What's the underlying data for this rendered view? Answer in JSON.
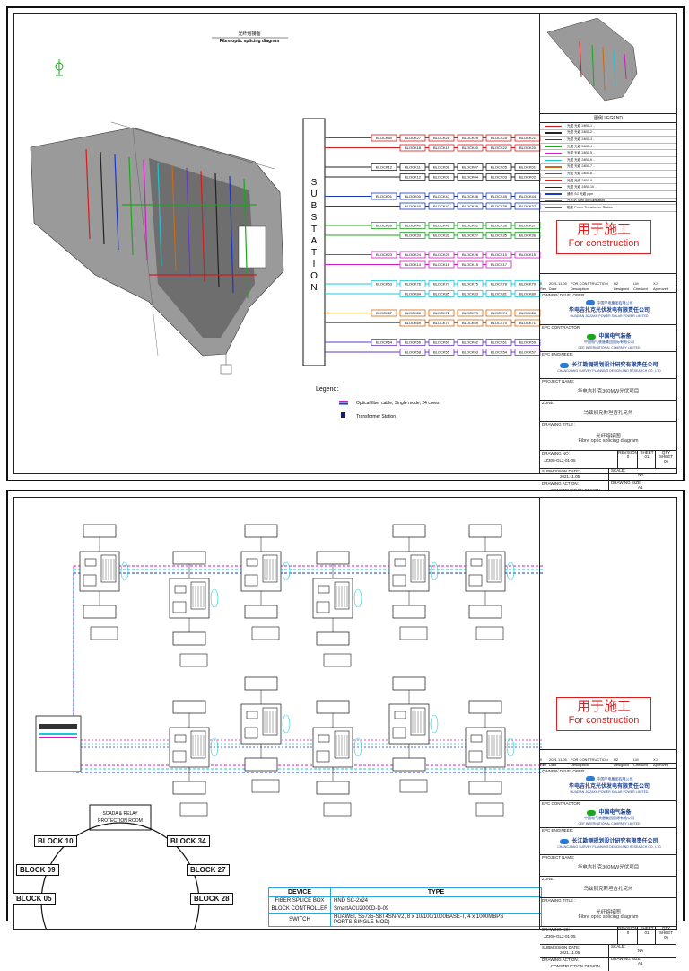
{
  "sheet1": {
    "title_cn": "光纤熔接图",
    "title_en": "Fibre optic splicing diagram",
    "substation_letters": [
      "S",
      "U",
      "B",
      "S",
      "T",
      "A",
      "T",
      "I",
      "O",
      "N"
    ],
    "block_rows": [
      {
        "color": "#d81b1b",
        "cells": [
          [
            "BLOCK50",
            "BLOCK27",
            "BLOCK28",
            "BLOCK29",
            "BLOCK25",
            "BLOCK21"
          ],
          [
            "BLOCK18",
            "BLOCK19",
            "BLOCK20",
            "BLOCK22",
            "BLOCK20"
          ]
        ]
      },
      {
        "color": "#222222",
        "cells": [
          [
            "BLOCK12",
            "BLOCK11",
            "BLOCK08",
            "BLOCK07",
            "BLOCK05",
            "BLOCK01"
          ],
          [
            "BLOCK12",
            "BLOCK09",
            "BLOCK04",
            "BLOCK03",
            "BLOCK02"
          ]
        ]
      },
      {
        "color": "#1a36c8",
        "cells": [
          [
            "BLOCK01",
            "BLOCK00",
            "BLOCK47",
            "BLOCK46",
            "BLOCK45",
            "BLOCK44"
          ],
          [
            "BLOCK40",
            "BLOCK43",
            "BLOCK39",
            "BLOCK38",
            "BLOCK37"
          ]
        ]
      },
      {
        "color": "#1aa81a",
        "cells": [
          [
            "BLOCK39",
            "BLOCK40",
            "BLOCK41",
            "BLOCK42",
            "BLOCK36",
            "BLOCK37"
          ],
          [
            "BLOCK33",
            "BLOCK32",
            "BLOCK27",
            "BLOCK35",
            "BLOCK36"
          ]
        ]
      },
      {
        "color": "#d318c8",
        "cells": [
          [
            "BLOCK23",
            "BLOCK24",
            "BLOCK25",
            "BLOCK26",
            "BLOCK10",
            "BLOCK15"
          ],
          [
            "BLOCK14",
            "BLOCK16",
            "BLOCK15",
            "BLOCK17"
          ]
        ]
      },
      {
        "color": "#18c8d8",
        "cells": [
          [
            "BLOCK63",
            "BLOCK76",
            "BLOCK77",
            "BLOCK75",
            "BLOCK78",
            "BLOCK79"
          ],
          [
            "BLOCK84",
            "BLOCK85",
            "BLOCK83",
            "BLOCK81",
            "BLOCK80"
          ]
        ]
      },
      {
        "color": "#c86a18",
        "cells": [
          [
            "BLOCK67",
            "BLOCK68",
            "BLOCK72",
            "BLOCK73",
            "BLOCK74",
            "BLOCK66"
          ],
          [
            "BLOCK69",
            "BLOCK70",
            "BLOCK69",
            "BLOCK70",
            "BLOCK71"
          ]
        ]
      },
      {
        "color": "#6a3ac8",
        "cells": [
          [
            "BLOCK64",
            "BLOCK56",
            "BLOCK60",
            "BLOCK62",
            "BLOCK61",
            "BLOCK59"
          ],
          [
            "BLOCK58",
            "BLOCK55",
            "BLOCK53",
            "BLOCK54",
            "BLOCK57"
          ]
        ]
      }
    ],
    "legend_title": "Legend:",
    "legend_items": [
      {
        "color": "#d318c8",
        "label": "Optical fiber cable, Single mode, 24 cores"
      },
      {
        "color": "#1a1a6a",
        "label": "Transformer Station"
      }
    ],
    "map_legend_title": "图例    LEGEND",
    "map_legend_rows": [
      "光缆 光缆 24B0-1 ..",
      "光缆 光缆 24B0-2 ..",
      "光缆 光缆 24B0-3 ..",
      "光缆 光缆 24B0-4 ..",
      "光缆 光缆 24B0-5 ..",
      "光缆 光缆 24B0-6 ..",
      "光缆 光缆 24B0-7 ..",
      "光缆 光缆 24B0-8 ..",
      "光缆 光缆 24B0-9 ..",
      "光缆 光缆 24B0-10 ..",
      "通讯 SC 光缆 pipe",
      "升压站 Step up Substation",
      "箱变 Power Transformer Station"
    ]
  },
  "sheet2": {
    "scada_label": "SCADA & RELAY PROTECTION ROOM",
    "ring_blocks": [
      "BLOCK 10",
      "BLOCK 34",
      "BLOCK 09",
      "BLOCK 27",
      "BLOCK 05",
      "BLOCK 28"
    ],
    "device_header": {
      "device": "DEVICE",
      "type": "TYPE"
    },
    "devices": [
      {
        "device": "FIBER SPLICE BOX",
        "type": "HND SC-2x24"
      },
      {
        "device": "BLOCK CONTROLLER",
        "type": "SmartACU2000D-D-09"
      },
      {
        "device": "SWITCH",
        "type": "HUAWEI, S5735-S8T4SN-V2, 8 x 10/100/1000BASE-T,  4 x 1000MBPS PORTS(SINGLE-MOD)"
      }
    ]
  },
  "title_block": {
    "stamp_cn": "用于施工",
    "stamp_en": "For construction",
    "rev_row": {
      "rev": "0",
      "date": "2021.11.05",
      "desc": "FOR CONSTRUCTION",
      "drawn": "HZ",
      "checked": "LM",
      "approved": "XJ"
    },
    "rev_headers": {
      "rev": "Rev",
      "date": "Date",
      "desc": "Description",
      "drawn": "Designed",
      "checked": "Checked",
      "approved": "Approved"
    },
    "owner_label": "OWNER/ DEVELOPER:",
    "owner_cn": "华电吉扎克光伏发电有限责任公司",
    "owner_en": "HUADIAN JIZZAKH POWER SOLAR POWER LIMITED",
    "owner_small": "中国华电集团有限公司",
    "epc_label": "EPC CONTRACTOR:",
    "epc_cn": "中国电气装备",
    "epc_sub": "中国电气装备集团国际有限公司",
    "epc_en": "CEE INTERNATIONAL COMPANY LIMITED",
    "eng_label": "EPC ENGINEER:",
    "eng_cn": "长江勘测规划设计研究有限责任公司",
    "eng_en": "CHANGJIANG SURVEY PLANNING DESIGN AND RESEARCH CO., LTD",
    "project_label": "PROJECT NAME:",
    "project_cn": "华电吉扎克300MW光伏项目",
    "zone_label": "ZONE:",
    "zone_cn": "乌兹别克斯坦吉扎克州",
    "dtitle_label": "DRAWING TITLE :",
    "dtitle_cn": "光纤熔接图",
    "dtitle_en": "Fibre optic splicing diagram",
    "dno_label": "DRAWING NO:",
    "dno_val": "JZ300-GL2-01-05",
    "revision_label": "REVISION",
    "revision_val": "0",
    "sheet_label": "SHEET",
    "sheet_val": "01",
    "qty_label": "QTY SHEET",
    "qty_val": "05",
    "sub_label": "SUBMISSION DATE:",
    "sub_val": "2021.11.05",
    "scale_label": "SCALE:",
    "scale_val": "NA",
    "action_label": "DRAWING ACTION:",
    "action_val": "CONSTRUCTION DESIGN",
    "size_label": "DRAWING SIZE:",
    "size_val": "A1"
  }
}
